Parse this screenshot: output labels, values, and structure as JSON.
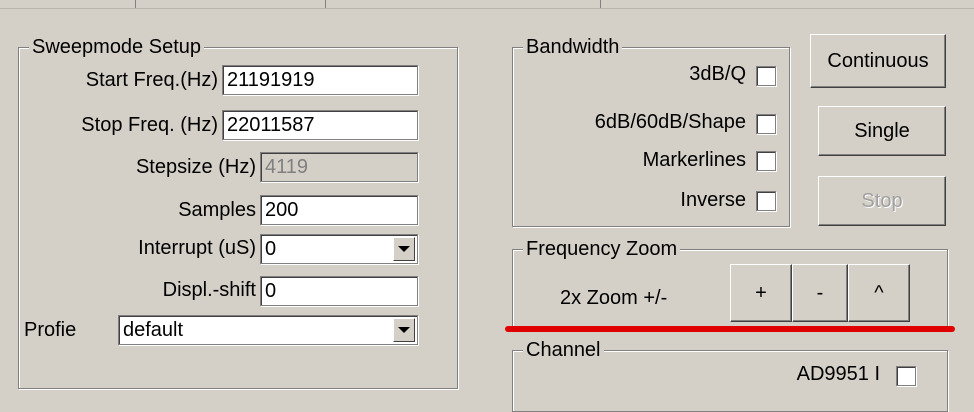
{
  "sweep": {
    "title": "Sweepmode Setup",
    "start_label": "Start Freq.(Hz)",
    "start_value": "21191919",
    "stop_label": "Stop Freq. (Hz)",
    "stop_value": "22011587",
    "stepsize_label": "Stepsize (Hz)",
    "stepsize_value": "4119",
    "samples_label": "Samples",
    "samples_value": "200",
    "interrupt_label": "Interrupt (uS)",
    "interrupt_value": "0",
    "displshift_label": "Displ.-shift",
    "displshift_value": "0",
    "profile_label": "Profie",
    "profile_value": "default"
  },
  "bandwidth": {
    "title": "Bandwidth",
    "options": [
      "3dB/Q",
      "6dB/60dB/Shape",
      "Markerlines",
      "Inverse"
    ]
  },
  "buttons": {
    "continuous": "Continuous",
    "single": "Single",
    "stop": "Stop"
  },
  "zoom": {
    "title": "Frequency Zoom",
    "label": "2x Zoom +/-",
    "plus": "+",
    "minus": "-",
    "caret": "^"
  },
  "channel": {
    "title": "Channel",
    "partial_label": "AD9951 I"
  },
  "colors": {
    "face": "#d4d0c8",
    "annotation_line": "#e00000"
  }
}
